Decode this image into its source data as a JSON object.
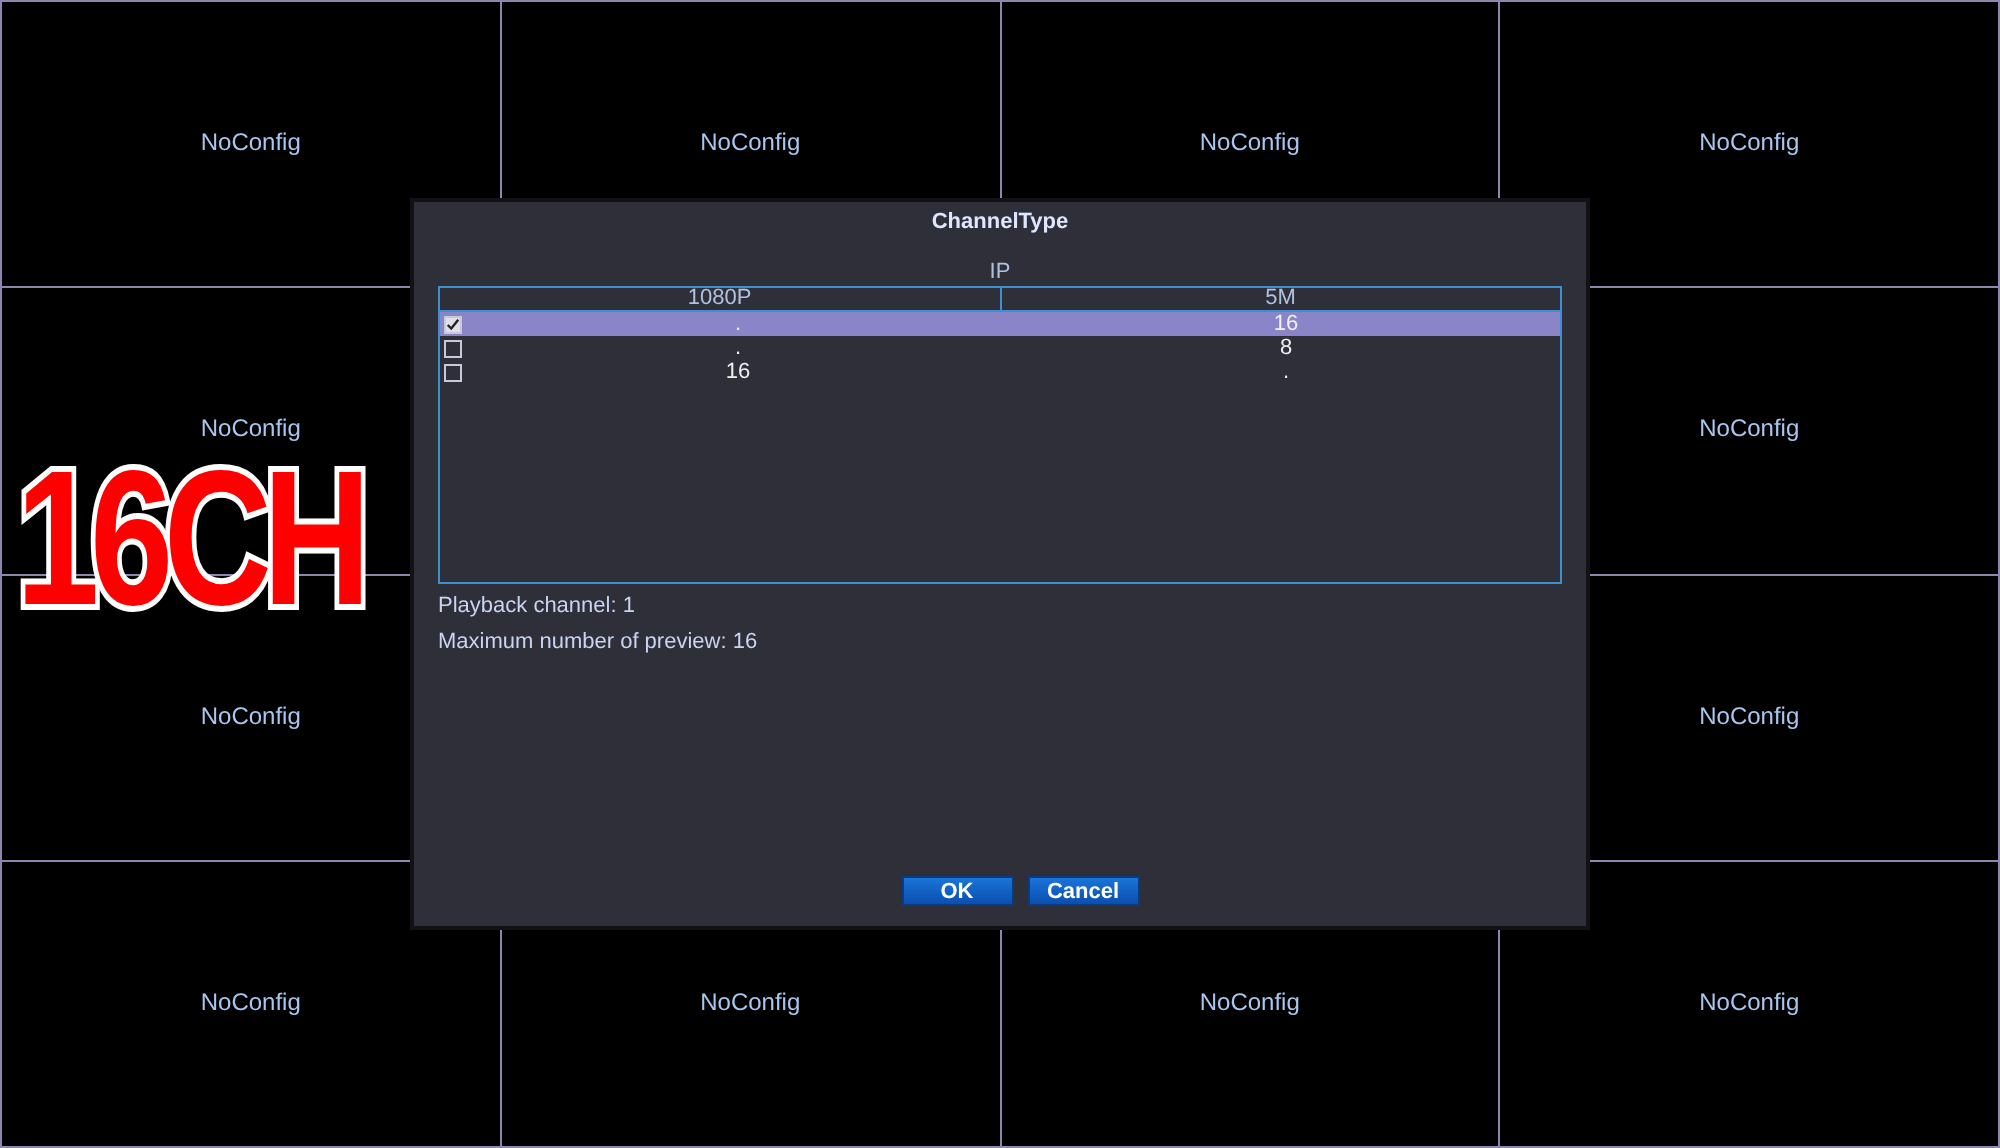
{
  "tile_grid": {
    "top_row": [
      "NoConfig",
      "NoConfig",
      "NoConfig",
      "NoConfig"
    ],
    "middle_rows": [
      {
        "left": "NoConfig",
        "right": "NoConfig"
      },
      {
        "left": "NoConfig",
        "right": "NoConfig"
      }
    ],
    "bottom_row": [
      "NoConfig",
      "NoConfig",
      "NoConfig",
      "NoConfig"
    ]
  },
  "overlay_badge": "16CH",
  "dialog": {
    "title": "ChannelType",
    "group_label": "IP",
    "table": {
      "columns": [
        "1080P",
        "5M"
      ],
      "rows": [
        {
          "checked": true,
          "selected": true,
          "cells": [
            ".",
            "16"
          ]
        },
        {
          "checked": false,
          "selected": false,
          "cells": [
            ".",
            "8"
          ]
        },
        {
          "checked": false,
          "selected": false,
          "cells": [
            "16",
            "."
          ]
        }
      ]
    },
    "info": [
      "Playback channel: 1",
      "Maximum number of preview: 16"
    ],
    "buttons": [
      "OK",
      "Cancel"
    ]
  }
}
